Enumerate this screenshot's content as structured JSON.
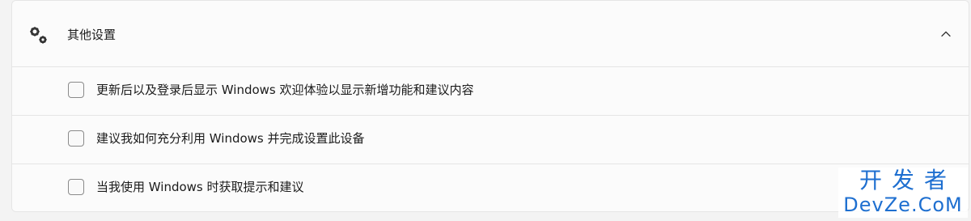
{
  "section": {
    "title": "其他设置",
    "icon": "gears-icon",
    "expand_icon": "chevron-up-icon"
  },
  "options": [
    {
      "label": "更新后以及登录后显示 Windows 欢迎体验以显示新增功能和建议内容",
      "checked": false
    },
    {
      "label": "建议我如何充分利用 Windows 并完成设置此设备",
      "checked": false
    },
    {
      "label": "当我使用 Windows 时获取提示和建议",
      "checked": false
    }
  ],
  "watermark": {
    "line1": "开发者",
    "line2": "DevZe.CoM"
  },
  "colors": {
    "accent": "#1e6fd0",
    "panel_bg": "#fbfbfb",
    "page_bg": "#f3f3f3",
    "text": "#1b1b1b"
  }
}
